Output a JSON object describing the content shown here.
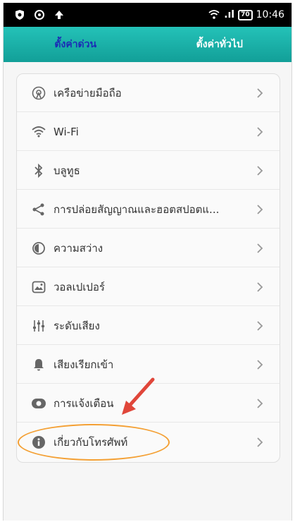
{
  "status_bar": {
    "time": "10:46",
    "battery": "70",
    "signal": ".ıl"
  },
  "tabs": [
    {
      "label": "ตั้งค่าด่วน",
      "active": true
    },
    {
      "label": "ตั้งค่าทั่วไป",
      "active": false
    }
  ],
  "settings": [
    {
      "label": "เครือข่ายมือถือ",
      "icon": "mobile-network-icon"
    },
    {
      "label": "Wi-Fi",
      "icon": "wifi-icon"
    },
    {
      "label": "บลูทูธ",
      "icon": "bluetooth-icon"
    },
    {
      "label": "การปล่อยสัญญาณและฮอตสปอตแ...",
      "icon": "share-icon"
    },
    {
      "label": "ความสว่าง",
      "icon": "brightness-icon"
    },
    {
      "label": "วอลเปเปอร์",
      "icon": "wallpaper-icon"
    },
    {
      "label": "ระดับเสียง",
      "icon": "volume-sliders-icon"
    },
    {
      "label": "เสียงเรียกเข้า",
      "icon": "bell-icon"
    },
    {
      "label": "การแจ้งเตือน",
      "icon": "notification-icon"
    },
    {
      "label": "เกี่ยวกับโทรศัพท์",
      "icon": "info-icon"
    }
  ],
  "colors": {
    "tab_bar": "#1aaea6",
    "active_tab_text": "#1b2db5",
    "highlight": "#f4a034",
    "arrow": "#e0463a"
  }
}
